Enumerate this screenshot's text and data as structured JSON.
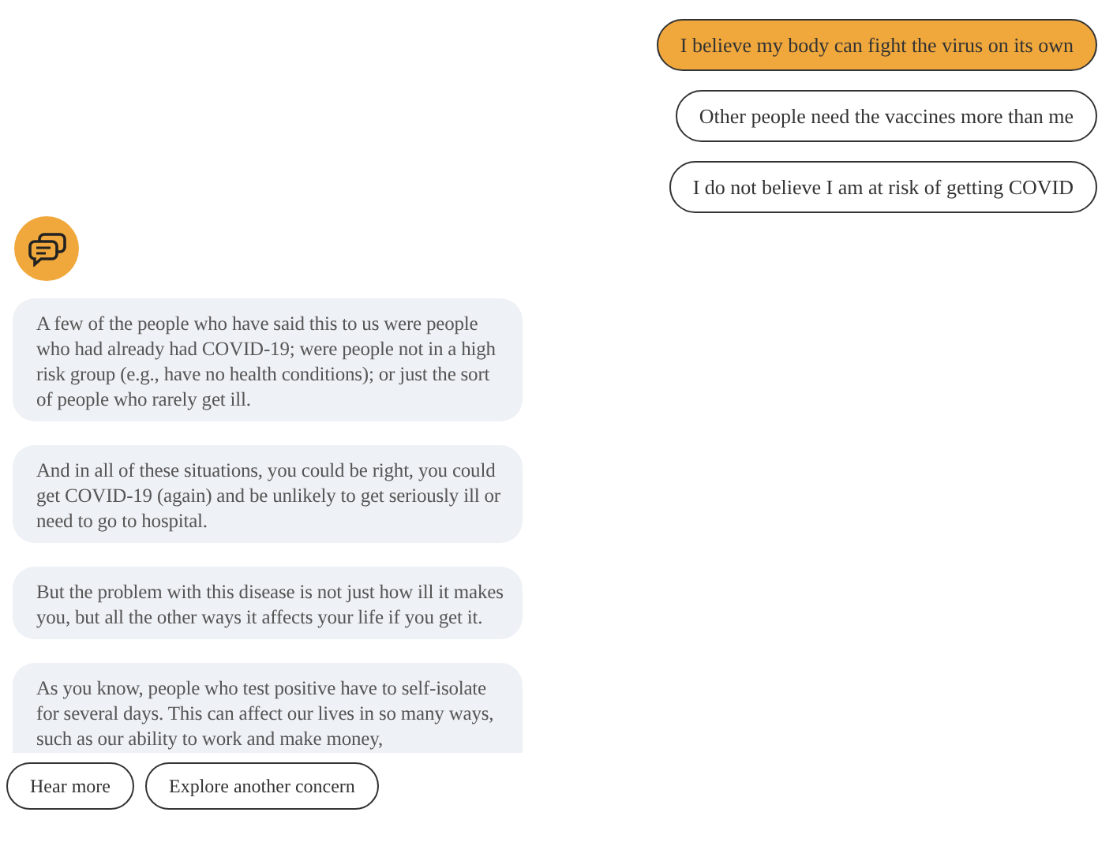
{
  "options": [
    {
      "label": "I believe my body can fight the virus on its own",
      "selected": true
    },
    {
      "label": "Other people need the vaccines more than me",
      "selected": false
    },
    {
      "label": "I do not believe I am at risk of getting COVID",
      "selected": false
    }
  ],
  "messages": [
    "A few of the people who have said this to us were people who had already had COVID-19; were people not in a high risk group (e.g., have no health conditions); or just the sort of people who rarely get ill.",
    "And in all of these situations, you could be right, you could get COVID-19 (again) and be unlikely to get seriously ill or need to go to hospital.",
    "But the problem with this disease is not just how ill it makes you, but all the other ways it affects your life if you get it.",
    "As you know, people who test positive have to self-isolate for several days. This can affect our lives in so many ways, such as our ability to work and make money,"
  ],
  "actions": [
    "Hear more",
    "Explore another concern"
  ]
}
